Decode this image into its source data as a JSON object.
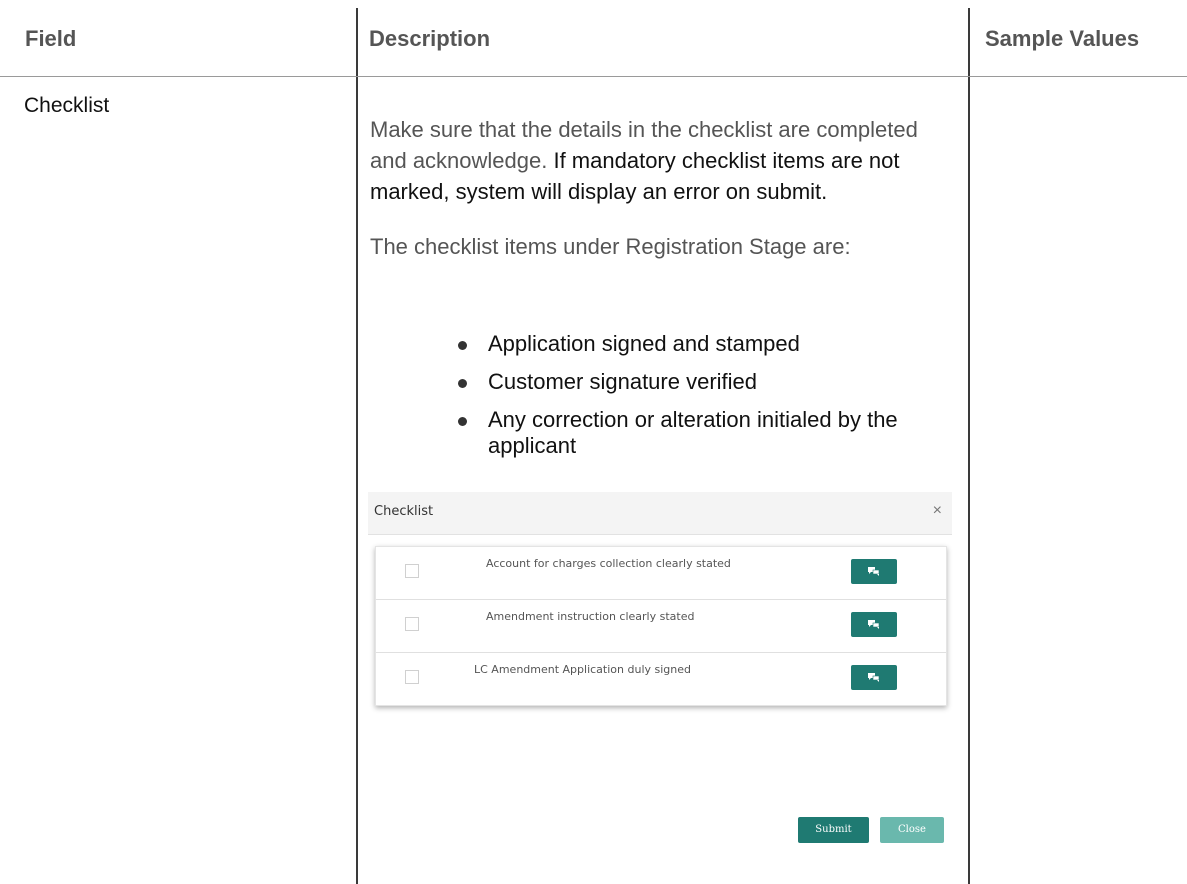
{
  "table": {
    "headers": [
      "Field",
      "Description",
      "Sample Values"
    ]
  },
  "row": {
    "field": "Checklist",
    "para1_part1": "Make sure that the details in the checklist are completed and acknowledge.",
    "para1_part2": " If mandatory checklist items are not marked, system will display an error on submit.",
    "para2": "The checklist items under Registration Stage are:",
    "bullets": [
      "Application signed and stamped",
      "Customer signature verified",
      "Any correction or alteration initialed by the applicant"
    ]
  },
  "modal": {
    "title": "Checklist",
    "close_glyph": "×",
    "items": [
      "Account for charges collection clearly stated",
      "Amendment instruction clearly stated",
      "LC Amendment Application duly signed"
    ],
    "submit_label": "Submit",
    "close_label": "Close"
  },
  "colors": {
    "accent": "#1f7a72",
    "accent_light": "#6ab8ad"
  }
}
